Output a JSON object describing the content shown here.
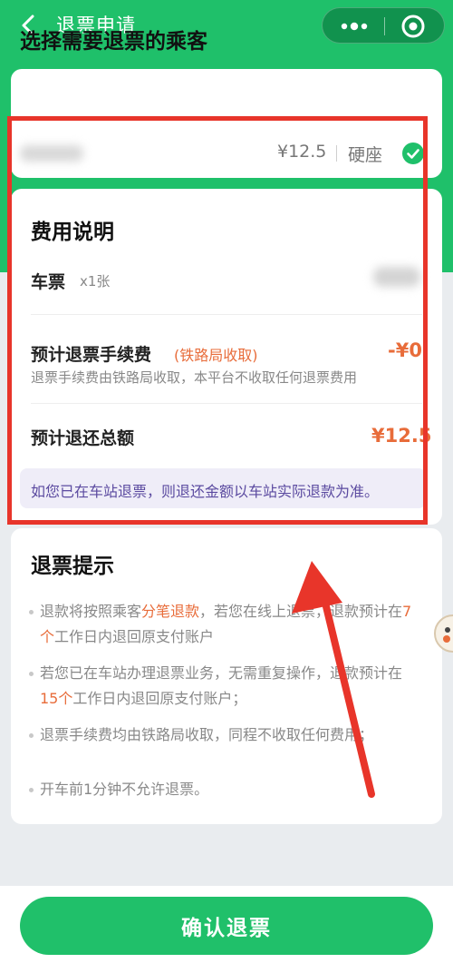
{
  "header": {
    "title": "退票申请"
  },
  "passenger": {
    "heading": "选择需要退票的乘客",
    "price": "¥12.5",
    "seat": "硬座"
  },
  "fee": {
    "heading": "费用说明",
    "ticket_label": "车票",
    "ticket_count": "x1张",
    "fee_label": "预计退票手续费",
    "fee_tag": "(铁路局收取)",
    "fee_value": "-¥0",
    "fee_note": "退票手续费由铁路局收取，本平台不收取任何退票费用",
    "total_label": "预计退还总额",
    "total_value": "¥12.5",
    "notice": "如您已在车站退票，则退还金额以车站实际退款为准。"
  },
  "tips": {
    "heading": "退票提示",
    "tip1_a": "退款将按照乘客",
    "tip1_hl1": "分笔退款",
    "tip1_b": "，若您在线上退票，退款预计在",
    "tip1_hl2": "7个",
    "tip1_c": "工作日内退回原支付账户",
    "tip2_a": "若您已在车站办理退票业务，无需重复操作，退款预计在",
    "tip2_hl": "15个",
    "tip2_b": "工作日内退回原支付账户；",
    "tip3": "退票手续费均由铁路局收取，同程不收取任何费用；",
    "tip4": "开车前1分钟不允许退票。"
  },
  "footer": {
    "confirm_label": "确认退票"
  },
  "colors": {
    "brand_green": "#1fc06a",
    "accent_orange": "#e86c3a",
    "annotation_red": "#e8352a"
  },
  "icons": [
    "back-icon",
    "more-icon",
    "target-icon",
    "check-circle-icon"
  ]
}
